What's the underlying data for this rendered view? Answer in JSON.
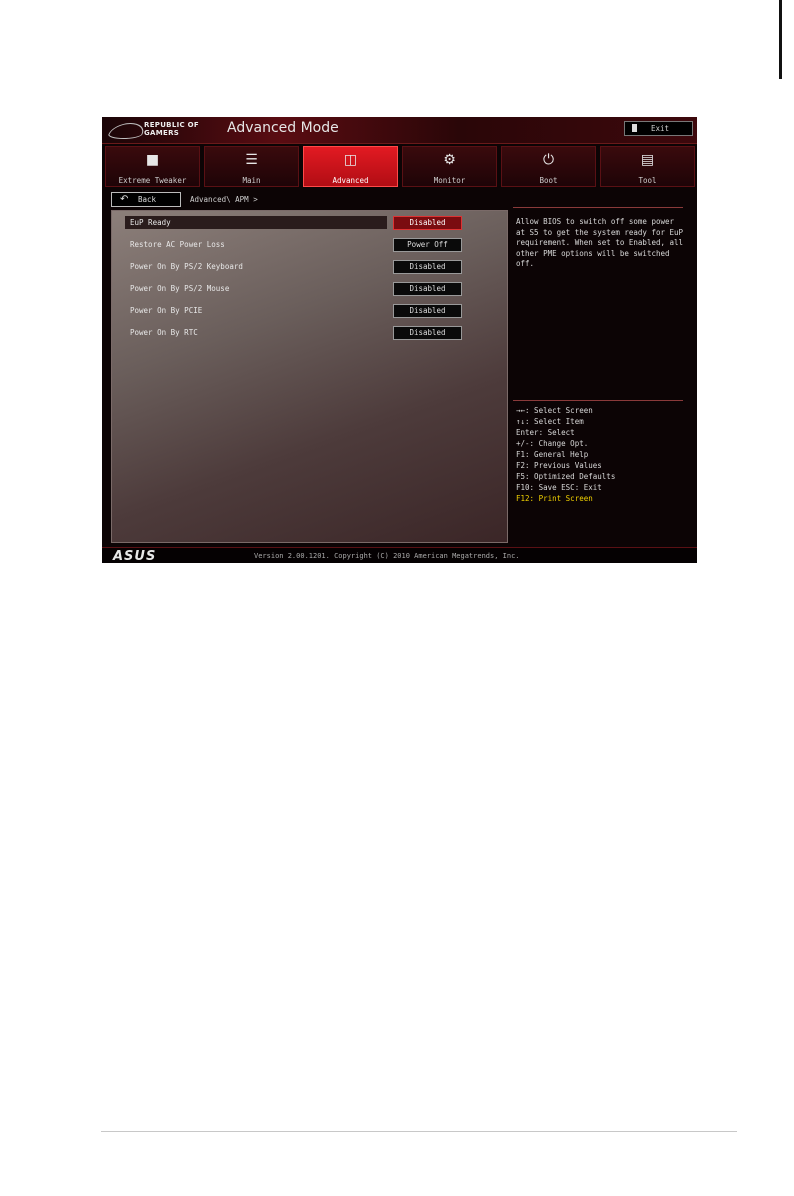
{
  "header": {
    "logo_line1": "REPUBLIC OF",
    "logo_line2": "GAMERS",
    "mode_title": "Advanced Mode",
    "exit_label": "Exit"
  },
  "tabs": [
    {
      "label": "Extreme Tweaker",
      "icon": "extreme-tweaker-icon",
      "active": false
    },
    {
      "label": "Main",
      "icon": "list-icon",
      "active": false
    },
    {
      "label": "Advanced",
      "icon": "advanced-icon",
      "active": true
    },
    {
      "label": "Monitor",
      "icon": "monitor-icon",
      "active": false
    },
    {
      "label": "Boot",
      "icon": "power-icon",
      "active": false
    },
    {
      "label": "Tool",
      "icon": "printer-icon",
      "active": false
    }
  ],
  "nav": {
    "back_label": "Back",
    "breadcrumb": "Advanced\\ APM >"
  },
  "settings": [
    {
      "label": "EuP Ready",
      "value": "Disabled",
      "selected": true
    },
    {
      "label": "Restore AC Power Loss",
      "value": "Power Off",
      "selected": false
    },
    {
      "label": "Power On By PS/2 Keyboard",
      "value": "Disabled",
      "selected": false
    },
    {
      "label": "Power On By PS/2 Mouse",
      "value": "Disabled",
      "selected": false
    },
    {
      "label": "Power On By PCIE",
      "value": "Disabled",
      "selected": false
    },
    {
      "label": "Power On By RTC",
      "value": "Disabled",
      "selected": false
    }
  ],
  "help_text": "Allow BIOS to switch off some power\nat S5 to get the system ready for EuP\nrequirement. When set to Enabled, all\nother PME options will be switched\noff.",
  "keys": [
    "→←: Select Screen",
    "↑↓: Select Item",
    "Enter: Select",
    "+/-: Change Opt.",
    "F1: General Help",
    "F2: Previous Values",
    "F5: Optimized Defaults",
    "F10: Save  ESC: Exit",
    "F12: Print Screen"
  ],
  "footer": {
    "brand": "ASUS",
    "version": "Version 2.00.1201. Copyright (C) 2010 American Megatrends, Inc."
  },
  "colors": {
    "accent": "#e21a22",
    "highlight_key": "#f2d200"
  }
}
